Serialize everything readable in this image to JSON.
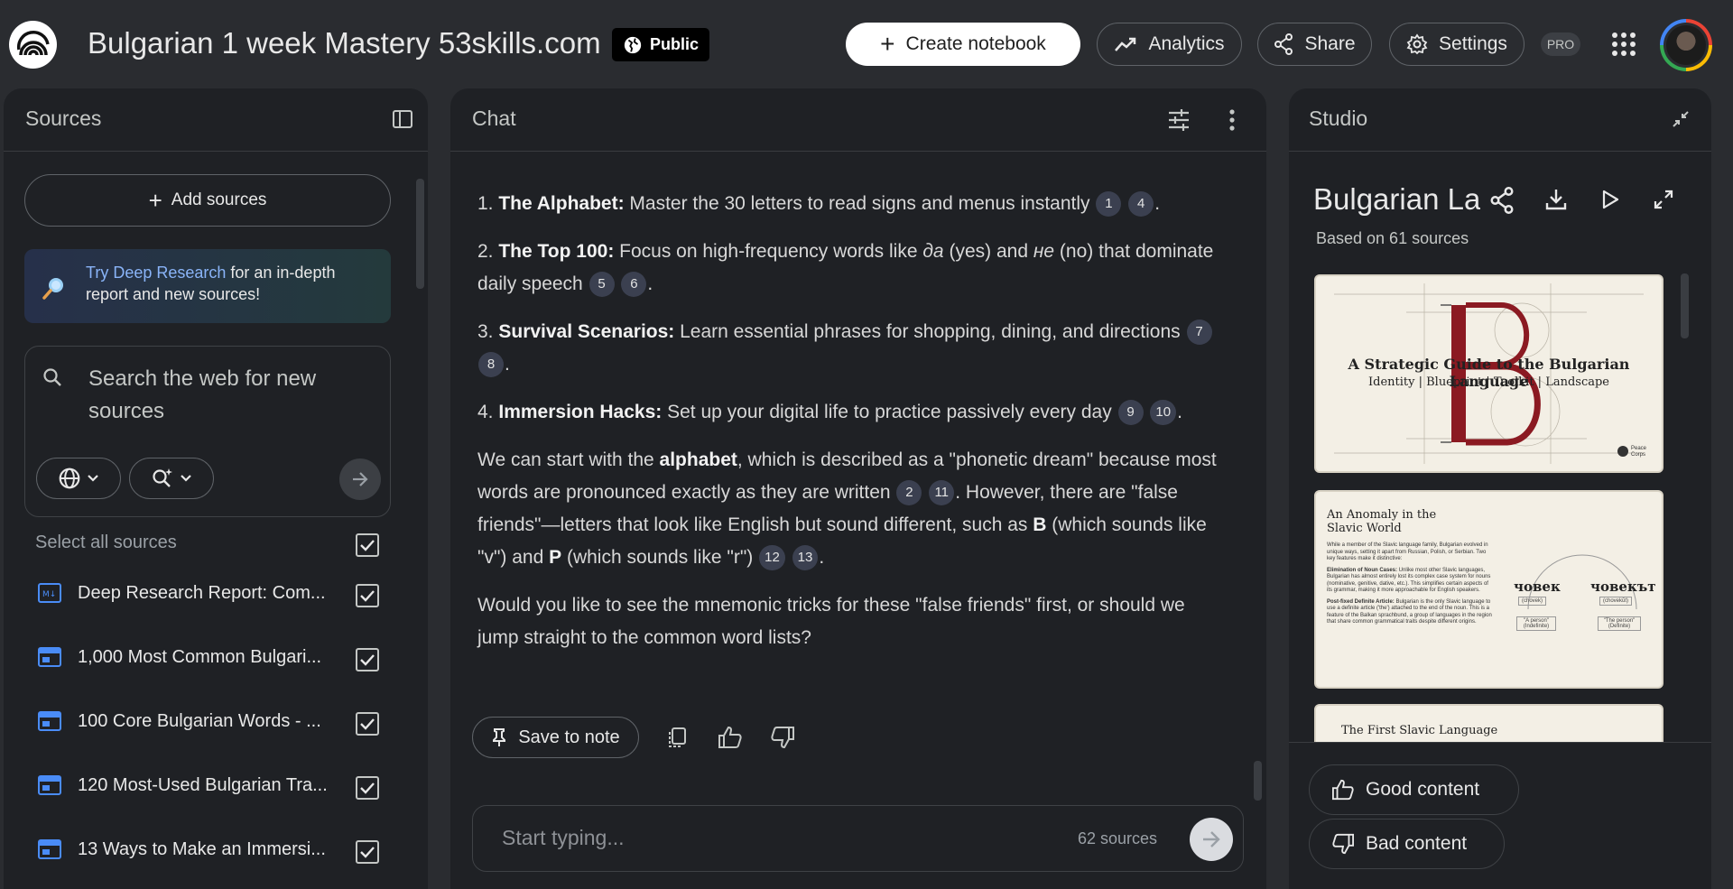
{
  "header": {
    "notebook_title": "Bulgarian 1 week Mastery 53skills.com",
    "public_label": "Public",
    "create_notebook_label": "Create notebook",
    "analytics_label": "Analytics",
    "share_label": "Share",
    "settings_label": "Settings",
    "pro_label": "PRO"
  },
  "sources": {
    "title": "Sources",
    "add_sources_label": "Add sources",
    "deep_research_link": "Try Deep Research",
    "deep_research_text": " for an in-depth report and new sources!",
    "search_placeholder": "Search the web for new sources",
    "select_all_label": "Select all sources",
    "items": [
      {
        "label": "Deep Research Report: Com...",
        "icon": "deep-research-icon"
      },
      {
        "label": "1,000 Most Common Bulgari...",
        "icon": "web-source-icon"
      },
      {
        "label": "100 Core Bulgarian Words - ...",
        "icon": "web-source-icon"
      },
      {
        "label": "120 Most-Used Bulgarian Tra...",
        "icon": "web-source-icon"
      },
      {
        "label": "13 Ways to Make an Immersi...",
        "icon": "web-source-icon"
      }
    ]
  },
  "chat": {
    "title": "Chat",
    "items": [
      {
        "num": "1.",
        "bold": "The Alphabet:",
        "text": " Master the 30 letters to read signs and menus instantly ",
        "cites": [
          "1",
          "4"
        ],
        "end": "."
      },
      {
        "num": "2.",
        "bold": "The Top 100:",
        "text_a": " Focus on high-frequency words like ",
        "em1": "да",
        "text_b": " (yes) and ",
        "em2": "не",
        "text_c": " (no) that dominate daily speech ",
        "cites": [
          "5",
          "6"
        ],
        "end": "."
      },
      {
        "num": "3.",
        "bold": "Survival Scenarios:",
        "text": " Learn essential phrases for shopping, dining, and directions ",
        "cites": [
          "7",
          "8"
        ],
        "end": "."
      },
      {
        "num": "4.",
        "bold": "Immersion Hacks:",
        "text": " Set up your digital life to practice passively every day ",
        "cites": [
          "9",
          "10"
        ],
        "end": "."
      }
    ],
    "para1": {
      "a": "We can start with the ",
      "b_bold": "alphabet",
      "c": ", which is described as a \"phonetic dream\" because most words are pronounced exactly as they are written ",
      "cites1": [
        "2",
        "11"
      ],
      "d": ". However, there are \"false friends\"—letters that look like English but sound different, such as ",
      "e_bold": "В",
      "f": " (which sounds like \"v\") and ",
      "g_bold": "Р",
      "h": " (which sounds like \"r\") ",
      "cites2": [
        "12",
        "13"
      ],
      "end": "."
    },
    "para2": "Would you like to see the mnemonic tricks for these \"false friends\" first, or should we jump straight to the common word lists?",
    "save_to_note_label": "Save to note",
    "input_placeholder": "Start typing...",
    "source_count": "62 sources"
  },
  "studio": {
    "title": "Studio",
    "doc_title": "Bulgarian La",
    "based_on": "Based on 61 sources",
    "slides": [
      {
        "title": "A Strategic Guide to the Bulgarian Language",
        "subtitle": "Identity | Blueprint | Toolkit | Landscape",
        "brand": "Peace Corps"
      },
      {
        "title": "An Anomaly in the Slavic World",
        "intro": "While a member of the Slavic language family, Bulgarian evolved in unique ways, setting it apart from Russian, Polish, or Serbian. Two key features make it distinctive:",
        "point1_bold": "Elimination of Noun Cases:",
        "point1": " Unlike most other Slavic languages, Bulgarian has almost entirely lost its complex case system for nouns (nominative, genitive, dative, etc.). This simplifies certain aspects of its grammar, making it more approachable for English speakers.",
        "point2_bold": "Post-fixed Definite Article:",
        "point2": " Bulgarian is the only Slavic language to use a definite article ('the') attached to the end of the noun. This is a feature of the Balkan sprachbund, a group of languages in the region that share common grammatical traits despite different origins.",
        "word1": "човек",
        "word1_translit": "(chovek)",
        "word1_gloss": "\"A person\" (Indefinite)",
        "word2": "човекът",
        "word2_translit": "(chovekŭt)",
        "word2_gloss": "\"The person\" (Definite)"
      },
      {
        "title": "The First Slavic Language"
      }
    ],
    "good_content_label": "Good content",
    "bad_content_label": "Bad content"
  },
  "colors": {
    "background": "#2a2c30",
    "panel": "#1f2125",
    "citation_chip": "#3b4050",
    "link": "#8ab4f8",
    "slide_accent": "#8b1a22"
  }
}
